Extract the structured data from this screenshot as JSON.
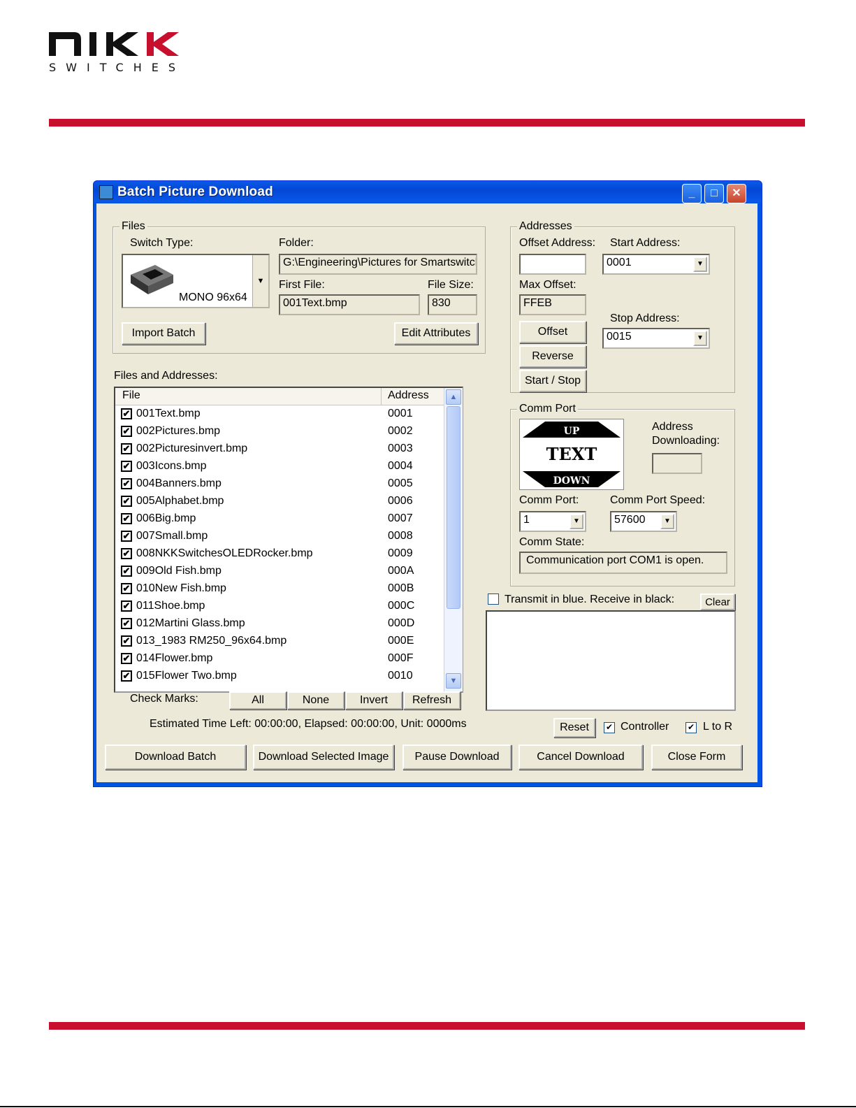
{
  "brand": {
    "logo_top": "NKK",
    "logo_bottom": "SWITCHES",
    "accent": "#c8102e"
  },
  "window": {
    "title": "Batch Picture Download",
    "controls": {
      "minimize": "_",
      "maximize": "□",
      "close": "✕"
    }
  },
  "files_group": {
    "legend": "Files",
    "switch_type_label": "Switch Type:",
    "switch_type_value": "MONO 96x64",
    "folder_label": "Folder:",
    "folder_value": "G:\\Engineering\\Pictures for Smartswitch",
    "first_file_label": "First File:",
    "first_file_value": "001Text.bmp",
    "file_size_label": "File Size:",
    "file_size_value": "830",
    "import_batch": "Import Batch",
    "edit_attributes": "Edit Attributes"
  },
  "addresses_group": {
    "legend": "Addresses",
    "offset_address_label": "Offset Address:",
    "offset_address_value": "",
    "start_address_label": "Start Address:",
    "start_address_value": "0001",
    "max_offset_label": "Max Offset:",
    "max_offset_value": "FFEB",
    "stop_address_label": "Stop Address:",
    "stop_address_value": "0015",
    "offset_button": "Offset",
    "reverse_button": "Reverse",
    "start_stop_button": "Start / Stop"
  },
  "list": {
    "label": "Files and Addresses:",
    "col_file": "File",
    "col_address": "Address",
    "rows": [
      {
        "file": "001Text.bmp",
        "address": "0001"
      },
      {
        "file": "002Pictures.bmp",
        "address": "0002"
      },
      {
        "file": "002Picturesinvert.bmp",
        "address": "0003"
      },
      {
        "file": "003Icons.bmp",
        "address": "0004"
      },
      {
        "file": "004Banners.bmp",
        "address": "0005"
      },
      {
        "file": "005Alphabet.bmp",
        "address": "0006"
      },
      {
        "file": "006Big.bmp",
        "address": "0007"
      },
      {
        "file": "007Small.bmp",
        "address": "0008"
      },
      {
        "file": "008NKKSwitchesOLEDRocker.bmp",
        "address": "0009"
      },
      {
        "file": "009Old Fish.bmp",
        "address": "000A"
      },
      {
        "file": "010New Fish.bmp",
        "address": "000B"
      },
      {
        "file": "011Shoe.bmp",
        "address": "000C"
      },
      {
        "file": "012Martini Glass.bmp",
        "address": "000D"
      },
      {
        "file": "013_1983 RM250_96x64.bmp",
        "address": "000E"
      },
      {
        "file": "014Flower.bmp",
        "address": "000F"
      },
      {
        "file": "015Flower Two.bmp",
        "address": "0010"
      }
    ],
    "checked": "✔",
    "check_marks_label": "Check Marks:",
    "all": "All",
    "none": "None",
    "invert": "Invert",
    "refresh": "Refresh"
  },
  "comm_group": {
    "legend": "Comm Port",
    "preview_up": "UP",
    "preview_text": "TEXT",
    "preview_down": "DOWN",
    "address_downloading_label": "Address Downloading:",
    "address_downloading_value": "",
    "comm_port_label": "Comm Port:",
    "comm_port_value": "1",
    "speed_label": "Comm Port Speed:",
    "speed_value": "57600",
    "state_label": "Comm State:",
    "state_value": "Communication port COM1 is open."
  },
  "transmit": {
    "label": "Transmit in blue. Receive in black:",
    "clear": "Clear",
    "log": ""
  },
  "status": "Estimated Time Left: 00:00:00, Elapsed: 00:00:00, Unit: 0000ms",
  "options": {
    "reset": "Reset",
    "controller": "Controller",
    "ltor": "L to R",
    "mark": "✔"
  },
  "bottom_buttons": {
    "download_batch": "Download Batch",
    "download_selected": "Download Selected Image",
    "pause": "Pause  Download",
    "cancel": "Cancel Download",
    "close": "Close Form"
  },
  "icons": {
    "dropdown": "▼",
    "scroll_up": "▲",
    "scroll_down": "▼"
  }
}
